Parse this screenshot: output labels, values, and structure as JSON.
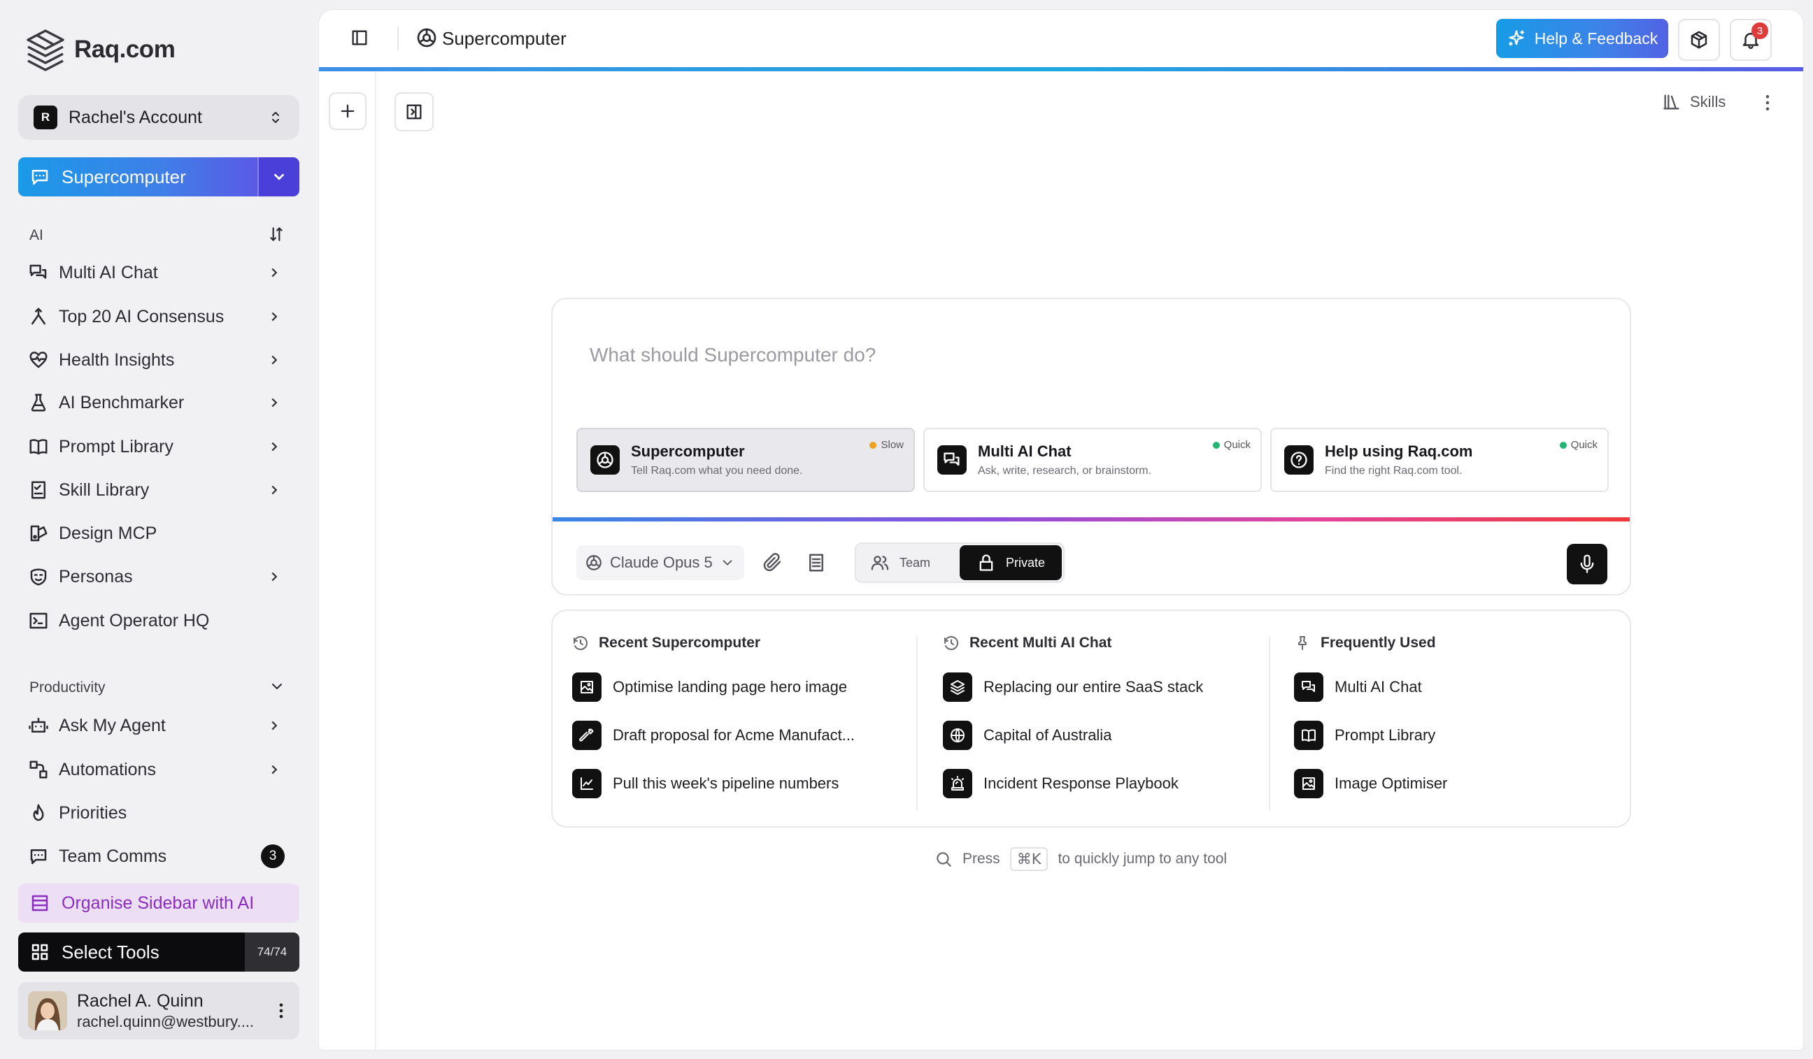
{
  "app": {
    "name": "Raq.com"
  },
  "account": {
    "initial": "R",
    "name": "Rachel's Account"
  },
  "primary_tool": {
    "label": "Supercomputer"
  },
  "sidebar": {
    "ai_section": {
      "title": "AI",
      "items": [
        {
          "label": "Multi AI Chat",
          "icon": "chat-icon",
          "has_chevron": true
        },
        {
          "label": "Top 20 AI Consensus",
          "icon": "merge-icon",
          "has_chevron": true
        },
        {
          "label": "Health Insights",
          "icon": "heart-pulse-icon",
          "has_chevron": true
        },
        {
          "label": "AI Benchmarker",
          "icon": "flask-icon",
          "has_chevron": true
        },
        {
          "label": "Prompt Library",
          "icon": "book-icon",
          "has_chevron": true
        },
        {
          "label": "Skill Library",
          "icon": "checklist-icon",
          "has_chevron": true
        },
        {
          "label": "Design MCP",
          "icon": "design-icon",
          "has_chevron": false
        },
        {
          "label": "Personas",
          "icon": "persona-icon",
          "has_chevron": true
        },
        {
          "label": "Agent Operator HQ",
          "icon": "terminal-icon",
          "has_chevron": false
        }
      ]
    },
    "productivity_section": {
      "title": "Productivity",
      "items": [
        {
          "label": "Ask My Agent",
          "icon": "bot-icon",
          "has_chevron": true
        },
        {
          "label": "Automations",
          "icon": "workflow-icon",
          "has_chevron": true
        },
        {
          "label": "Priorities",
          "icon": "flame-icon",
          "has_chevron": false
        },
        {
          "label": "Team Comms",
          "icon": "message-icon",
          "has_chevron": false,
          "badge": "3"
        }
      ]
    },
    "organise_label": "Organise Sidebar with AI",
    "select_tools_label": "Select Tools",
    "select_tools_count": "74/74",
    "user": {
      "name": "Rachel A. Quinn",
      "email": "rachel.quinn@westbury...."
    }
  },
  "header": {
    "title": "Supercomputer",
    "help_label": "Help & Feedback",
    "notification_count": "3",
    "skills_label": "Skills"
  },
  "prompt": {
    "placeholder": "What should Supercomputer do?",
    "modes": [
      {
        "title": "Supercomputer",
        "subtitle": "Tell Raq.com what you need done.",
        "speed": "Slow",
        "speed_color": "#f0a020",
        "active": true
      },
      {
        "title": "Multi AI Chat",
        "subtitle": "Ask, write, research, or brainstorm.",
        "speed": "Quick",
        "speed_color": "#22b573",
        "active": false
      },
      {
        "title": "Help using Raq.com",
        "subtitle": "Find the right Raq.com tool.",
        "speed": "Quick",
        "speed_color": "#22b573",
        "active": false
      }
    ],
    "model": "Claude Opus 5",
    "team_label": "Team",
    "private_label": "Private"
  },
  "recent": {
    "supercomputer": {
      "title": "Recent Supercomputer",
      "items": [
        "Optimise landing page hero image",
        "Draft proposal for Acme Manufact...",
        "Pull this week's pipeline numbers"
      ]
    },
    "multi_ai_chat": {
      "title": "Recent Multi AI Chat",
      "items": [
        "Replacing our entire SaaS stack",
        "Capital of Australia",
        "Incident Response Playbook"
      ]
    },
    "frequently_used": {
      "title": "Frequently Used",
      "items": [
        "Multi AI Chat",
        "Prompt Library",
        "Image Optimiser"
      ]
    }
  },
  "hint": {
    "before": "Press",
    "key": "⌘K",
    "after": "to quickly jump to any tool"
  },
  "colors": {
    "accent_blue": "#1a9ae8",
    "accent_indigo": "#4a3fd8",
    "organise_purple": "#8a2dbf",
    "notification_red": "#e03b3b"
  }
}
